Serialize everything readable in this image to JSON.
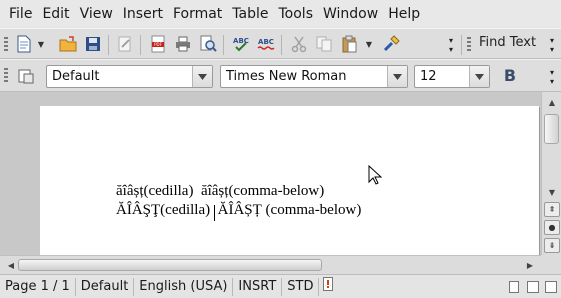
{
  "menubar": {
    "items": [
      "File",
      "Edit",
      "View",
      "Insert",
      "Format",
      "Table",
      "Tools",
      "Window",
      "Help"
    ]
  },
  "toolbar": {
    "find_text_label": "Find Text",
    "icons": [
      "new-document",
      "open",
      "save",
      "edit-file",
      "export-pdf",
      "print",
      "print-preview",
      "spellcheck",
      "autospellcheck",
      "cut",
      "copy",
      "paste",
      "clone-formatting"
    ]
  },
  "formatting": {
    "paragraph_style": "Default",
    "font_name": "Times New Roman",
    "font_size": "12",
    "bold_label": "B"
  },
  "document": {
    "line1": "ăîâșț(cedilla)  ăîâșț(comma-below)",
    "line2": "ĂÎÂŞŢ(cedilla)  ĂÎÂȘȚ (comma-below)"
  },
  "statusbar": {
    "page": "Page 1 / 1",
    "style": "Default",
    "language": "English (USA)",
    "insert_mode": "INSRT",
    "selection_mode": "STD"
  },
  "colors": {
    "workspace": "#c8c8c8",
    "page": "#ffffff",
    "toolbar": "#dedede"
  }
}
